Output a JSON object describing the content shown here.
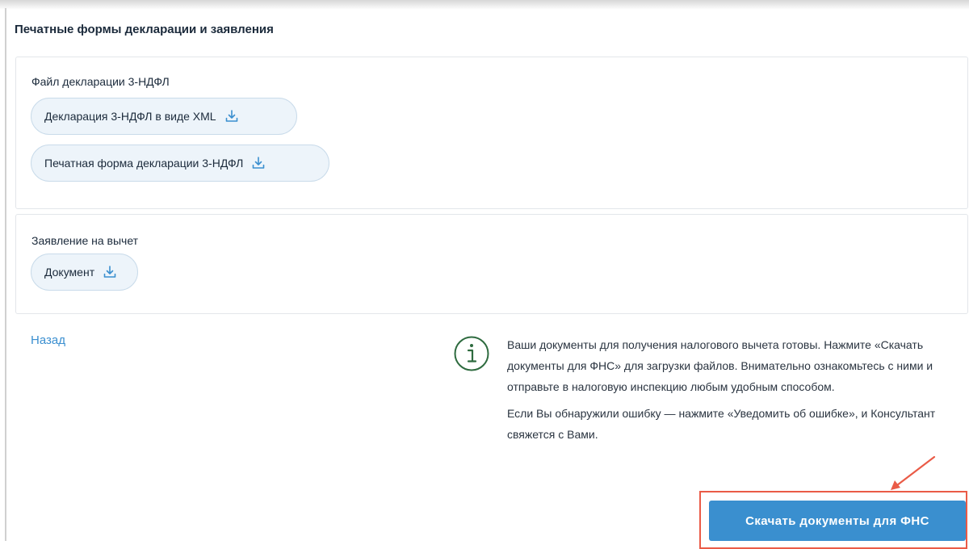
{
  "section": {
    "title": "Печатные формы декларации и заявления"
  },
  "declaration_card": {
    "label": "Файл декларации 3-НДФЛ",
    "buttons": [
      {
        "label": "Декларация 3-НДФЛ в виде XML",
        "icon": "download-icon"
      },
      {
        "label": "Печатная форма декларации 3-НДФЛ",
        "icon": "download-icon"
      }
    ]
  },
  "application_card": {
    "label": "Заявление на вычет",
    "buttons": [
      {
        "label": "Документ",
        "icon": "download-icon"
      }
    ]
  },
  "footer": {
    "back_label": "Назад",
    "info": {
      "icon": "info-icon",
      "paragraph1": "Ваши документы для получения налогового вычета готовы. Нажмите «Скачать документы для ФНС» для загрузки файлов. Внимательно ознакомьтесь с ними и отправьте в налоговую инспекцию любым удобным способом.",
      "paragraph2": "Если Вы обнаружили ошибку — нажмите «Уведомить об ошибке», и Консультант свяжется с Вами."
    },
    "primary_button_label": "Скачать документы для ФНС"
  },
  "colors": {
    "accent": "#3a8fcf",
    "pill_bg": "#edf4fa",
    "pill_border": "#c9dbea",
    "highlight": "#ea5b47",
    "info_icon": "#2e6b3f"
  }
}
